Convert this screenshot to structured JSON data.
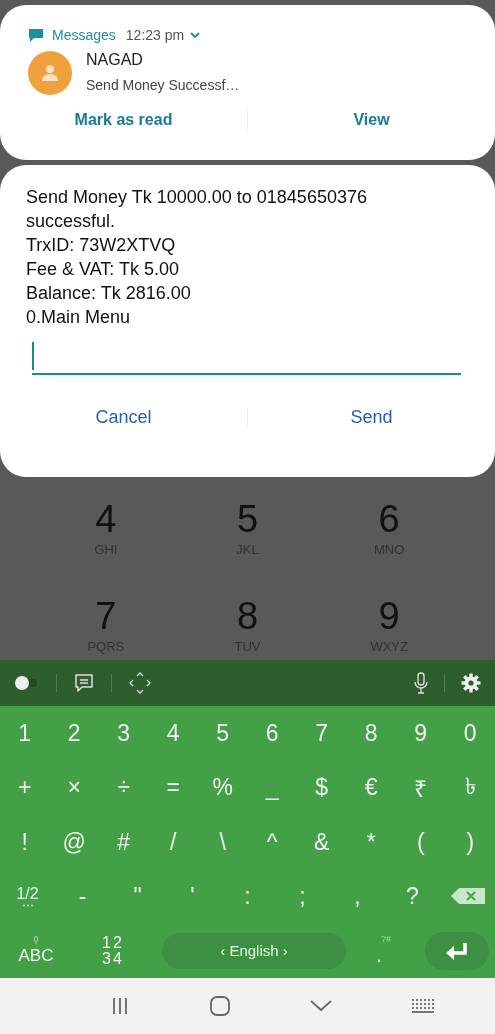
{
  "notification": {
    "app": "Messages",
    "time": "12:23 pm",
    "sender": "NAGAD",
    "preview": "Send Money Successf…",
    "actions": [
      "Mark as read",
      "View"
    ]
  },
  "dialog": {
    "message": [
      "Send Money Tk 10000.00 to 01845650376 successful.",
      "TrxID: 73W2XTVQ",
      "Fee & VAT: Tk 5.00",
      "Balance: Tk 2816.00",
      "0.Main Menu"
    ],
    "buttons": [
      "Cancel",
      "Send"
    ]
  },
  "dialer": [
    {
      "digit": "4",
      "letters": "GHI"
    },
    {
      "digit": "5",
      "letters": "JKL"
    },
    {
      "digit": "6",
      "letters": "MNO"
    },
    {
      "digit": "7",
      "letters": "PQRS"
    },
    {
      "digit": "8",
      "letters": "TUV"
    },
    {
      "digit": "9",
      "letters": "WXYZ"
    }
  ],
  "keyboard": {
    "toggle_on": false,
    "rows": [
      [
        "1",
        "2",
        "3",
        "4",
        "5",
        "6",
        "7",
        "8",
        "9",
        "0"
      ],
      [
        "+",
        "×",
        "÷",
        "=",
        "%",
        "_",
        "$",
        "€",
        "₹",
        "৳"
      ],
      [
        "!",
        "@",
        "#",
        "/",
        "\\",
        "^",
        "&",
        "*",
        "(",
        ")"
      ]
    ],
    "row_4": [
      {
        "kind": "page",
        "label": "1/2"
      },
      {
        "kind": "char",
        "label": "-"
      },
      {
        "kind": "char",
        "label": "\""
      },
      {
        "kind": "char",
        "label": "'"
      },
      {
        "kind": "char",
        "label": ":"
      },
      {
        "kind": "char",
        "label": ";"
      },
      {
        "kind": "char",
        "label": ","
      },
      {
        "kind": "char",
        "label": "?"
      },
      {
        "kind": "backspace"
      }
    ],
    "row_5": [
      {
        "kind": "abc",
        "label": "ABC"
      },
      {
        "kind": "numpad",
        "lines": [
          "12",
          "34"
        ]
      },
      {
        "kind": "space",
        "label": "‹ English ›"
      },
      {
        "kind": "period",
        "label": ".",
        "hint": "?#"
      },
      {
        "kind": "enter"
      }
    ]
  }
}
